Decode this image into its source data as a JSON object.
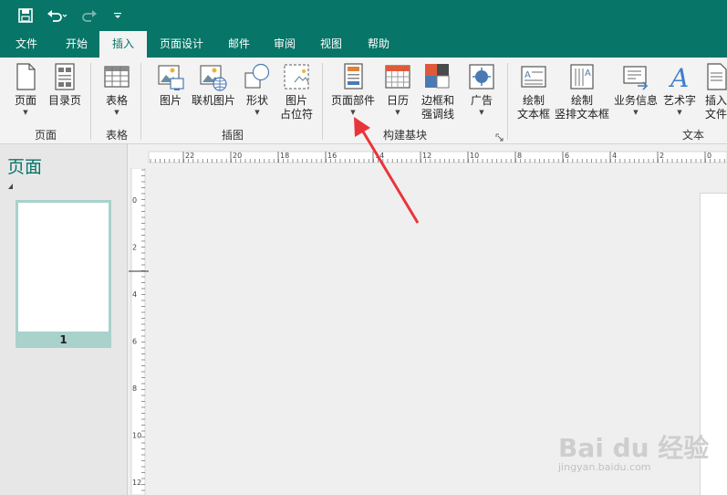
{
  "quick_access": {
    "save_icon": "save-icon",
    "undo_icon": "undo-icon",
    "redo_icon": "redo-icon",
    "customize_icon": "customize-qat-icon"
  },
  "tabs": [
    {
      "label": "文件"
    },
    {
      "label": "开始"
    },
    {
      "label": "插入",
      "active": true
    },
    {
      "label": "页面设计"
    },
    {
      "label": "邮件"
    },
    {
      "label": "审阅"
    },
    {
      "label": "视图"
    },
    {
      "label": "帮助"
    }
  ],
  "ribbon": {
    "groups": {
      "pages": "页面",
      "tables": "表格",
      "illustrations": "插图",
      "building_blocks": "构建基块",
      "text": "文本"
    },
    "buttons": {
      "page": "页面",
      "catalog_page": "目录页",
      "table": "表格",
      "picture": "图片",
      "online_picture": "联机图片",
      "shapes": "形状",
      "picture_placeholder_1": "图片",
      "picture_placeholder_2": "占位符",
      "page_parts": "页面部件",
      "calendar": "日历",
      "borders_1": "边框和",
      "borders_2": "强调线",
      "ads": "广告",
      "draw_textbox_1": "绘制",
      "draw_textbox_2": "文本框",
      "draw_vertical_1": "绘制",
      "draw_vertical_2": "竖排文本框",
      "business_info": "业务信息",
      "wordart": "艺术字",
      "insert_file_1": "插入",
      "insert_file_2": "文件"
    }
  },
  "pages_pane": {
    "title": "页面",
    "page_number": "1"
  },
  "hruler_labels": [
    "22",
    "20",
    "18",
    "16",
    "14",
    "12",
    "10",
    "8",
    "6",
    "4",
    "2",
    "0",
    "2",
    "4"
  ],
  "vruler_labels": [
    "0",
    "2",
    "4",
    "6",
    "8",
    "10",
    "12"
  ],
  "watermark": {
    "brand": "Bai du 经验",
    "url": "jingyan.baidu.com"
  },
  "colors": {
    "accent": "#077568",
    "arrow": "#e8353b"
  }
}
